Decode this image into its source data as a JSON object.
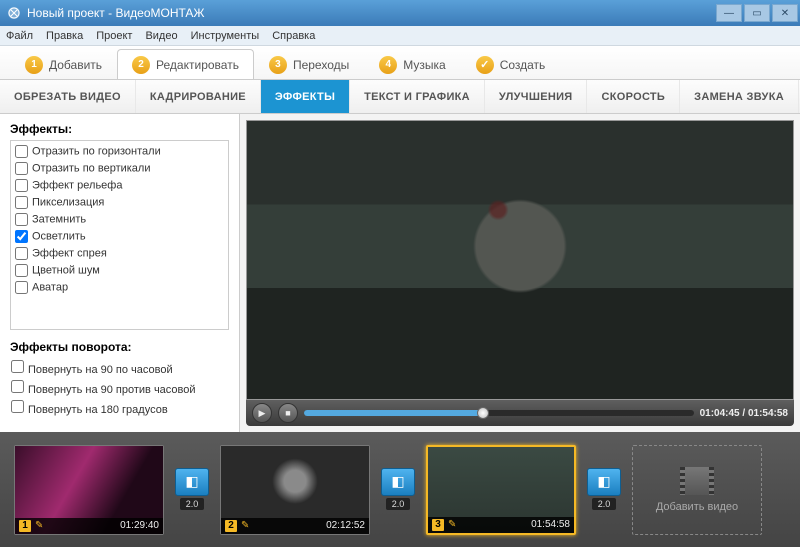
{
  "window": {
    "title": "Новый проект - ВидеоМОНТАЖ"
  },
  "menu": {
    "file": "Файл",
    "edit": "Правка",
    "project": "Проект",
    "video": "Видео",
    "tools": "Инструменты",
    "help": "Справка"
  },
  "steps": {
    "add": "Добавить",
    "edit": "Редактировать",
    "transitions": "Переходы",
    "music": "Музыка",
    "create": "Создать",
    "n1": "1",
    "n2": "2",
    "n3": "3",
    "n4": "4",
    "check": "✓"
  },
  "subtabs": {
    "trim": "ОБРЕЗАТЬ ВИДЕО",
    "crop": "КАДРИРОВАНИЕ",
    "effects": "ЭФФЕКТЫ",
    "text": "ТЕКСТ И ГРАФИКА",
    "enhance": "УЛУЧШЕНИЯ",
    "speed": "СКОРОСТЬ",
    "audio": "ЗАМЕНА ЗВУКА"
  },
  "panel": {
    "effectsHeading": "Эффекты:",
    "rotationHeading": "Эффекты поворота:",
    "fx": {
      "flipH": "Отразить по горизонтали",
      "flipV": "Отразить по вертикали",
      "relief": "Эффект рельефа",
      "pixel": "Пикселизация",
      "darken": "Затемнить",
      "lighten": "Осветлить",
      "spray": "Эффект спрея",
      "noise": "Цветной шум",
      "avatar": "Аватар"
    },
    "rot": {
      "cw90": "Повернуть на 90 по часовой",
      "ccw90": "Повернуть на 90 против часовой",
      "r180": "Повернуть на 180 градусов"
    }
  },
  "player": {
    "current": "01:04:45",
    "total": "01:54:58",
    "sep": " / "
  },
  "timeline": {
    "trans": "2.0",
    "addVideo": "Добавить видео",
    "clips": [
      {
        "num": "1",
        "time": "01:29:40"
      },
      {
        "num": "2",
        "time": "02:12:52"
      },
      {
        "num": "3",
        "time": "01:54:58"
      }
    ]
  }
}
